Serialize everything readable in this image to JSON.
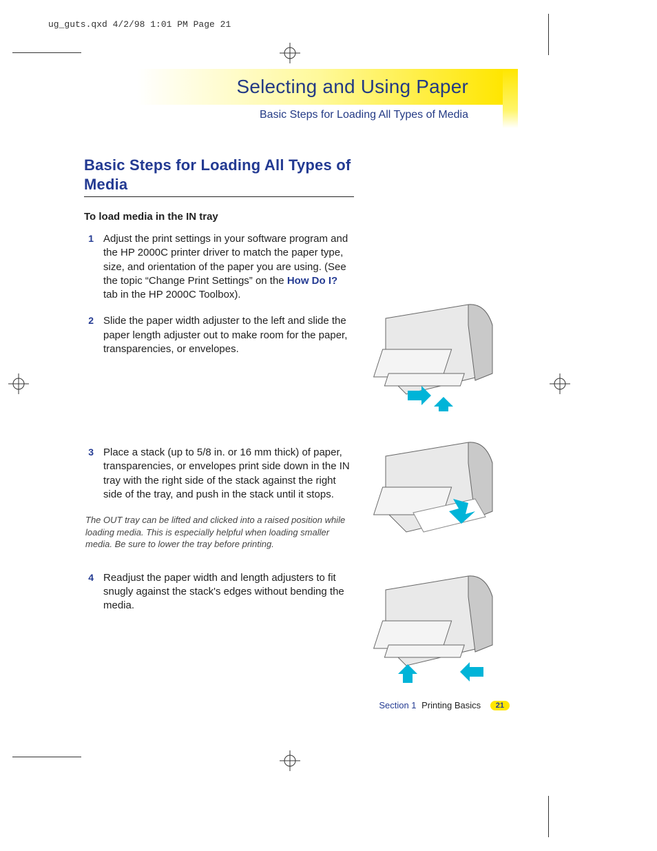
{
  "print_header": "ug_guts.qxd  4/2/98  1:01 PM  Page 21",
  "banner": {
    "title": "Selecting and Using Paper",
    "subtitle": "Basic Steps for Loading All Types of Media"
  },
  "heading": "Basic Steps for Loading All Types of Media",
  "subheading": "To load media in the IN tray",
  "steps": {
    "s1": {
      "num": "1",
      "text_a": "Adjust the print settings in your software program and the HP 2000C printer driver to match the paper type, size, and orientation of the paper you are using. (See the topic “Change Print Settings” on the ",
      "emph": "How Do I?",
      "text_b": " tab in the HP 2000C Toolbox)."
    },
    "s2": {
      "num": "2",
      "text": "Slide the paper width adjuster to the left and slide the paper length adjuster out to make room for the paper, transparencies, or envelopes."
    },
    "s3": {
      "num": "3",
      "text": "Place a stack (up to 5/8 in. or 16 mm thick) of paper, transparencies, or envelopes print side down in the IN tray with the right side of the stack against the right side of the tray, and push in the stack until it stops."
    },
    "note": "The OUT tray can be lifted and clicked into a raised position while loading media. This is especially helpful when loading smaller media. Be sure to lower the tray before printing.",
    "s4": {
      "num": "4",
      "text": "Readjust the paper width and length adjusters to fit snugly against the stack's edges without bending the media."
    }
  },
  "footer": {
    "section": "Section 1",
    "label": "Printing Basics",
    "page": "21"
  }
}
